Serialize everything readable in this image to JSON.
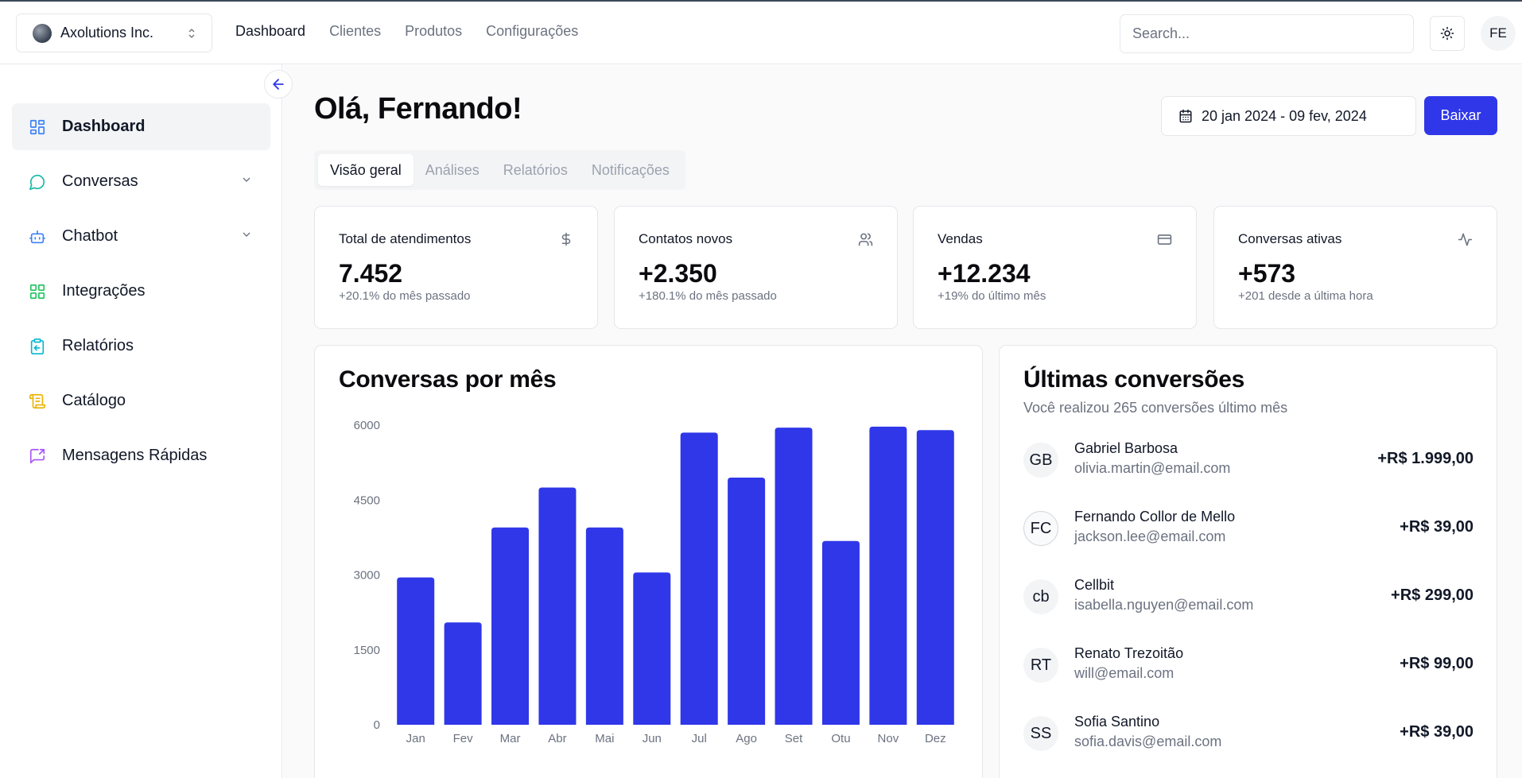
{
  "org": {
    "name": "Axolutions Inc."
  },
  "nav": [
    "Dashboard",
    "Clientes",
    "Produtos",
    "Configurações"
  ],
  "search": {
    "placeholder": "Search..."
  },
  "user": {
    "initials": "FE"
  },
  "sidebar": {
    "items": [
      {
        "label": "Dashboard",
        "icon": "grid-icon",
        "color": "#3b82f6",
        "active": true,
        "expandable": false
      },
      {
        "label": "Conversas",
        "icon": "message-circle-icon",
        "color": "#14b8a6",
        "active": false,
        "expandable": true
      },
      {
        "label": "Chatbot",
        "icon": "bot-icon",
        "color": "#3b82f6",
        "active": false,
        "expandable": true
      },
      {
        "label": "Integrações",
        "icon": "blocks-icon",
        "color": "#22c55e",
        "active": false,
        "expandable": false
      },
      {
        "label": "Relatórios",
        "icon": "clipboard-icon",
        "color": "#06b6d4",
        "active": false,
        "expandable": false
      },
      {
        "label": "Catálogo",
        "icon": "scroll-icon",
        "color": "#eab308",
        "active": false,
        "expandable": false
      },
      {
        "label": "Mensagens Rápidas",
        "icon": "message-share-icon",
        "color": "#a855f7",
        "active": false,
        "expandable": false
      }
    ]
  },
  "main": {
    "greeting": "Olá, Fernando!",
    "date_range": "20 jan 2024 - 09 fev, 2024",
    "download_label": "Baixar",
    "tabs": [
      "Visão geral",
      "Análises",
      "Relatórios",
      "Notificações"
    ],
    "active_tab": "Visão geral"
  },
  "stats": [
    {
      "title": "Total de atendimentos",
      "value": "7.452",
      "sub": "+20.1% do mês passado",
      "icon": "dollar-icon"
    },
    {
      "title": "Contatos novos",
      "value": "+2.350",
      "sub": "+180.1% do mês passado",
      "icon": "users-icon"
    },
    {
      "title": "Vendas",
      "value": "+12.234",
      "sub": "+19% do último mês",
      "icon": "credit-card-icon"
    },
    {
      "title": "Conversas ativas",
      "value": "+573",
      "sub": "+201 desde a última hora",
      "icon": "activity-icon"
    }
  ],
  "chart": {
    "title": "Conversas por mês"
  },
  "chart_data": {
    "type": "bar",
    "title": "Conversas por mês",
    "categories": [
      "Jan",
      "Fev",
      "Mar",
      "Abr",
      "Mai",
      "Jun",
      "Jul",
      "Ago",
      "Set",
      "Otu",
      "Nov",
      "Dez"
    ],
    "values": [
      2950,
      2050,
      3950,
      4750,
      3950,
      3050,
      5850,
      4950,
      5950,
      3680,
      5970,
      5900
    ],
    "yticks": [
      0,
      1500,
      3000,
      4500,
      6000
    ],
    "ylim": [
      0,
      6000
    ],
    "bar_color": "#2f37e8",
    "grid": false
  },
  "conversions": {
    "title": "Últimas conversões",
    "subtitle": "Você realizou 265 conversões último mês",
    "items": [
      {
        "initials": "GB",
        "name": "Gabriel Barbosa",
        "email": "olivia.martin@email.com",
        "amount": "+R$ 1.999,00"
      },
      {
        "initials": "FC",
        "name": "Fernando Collor de Mello",
        "email": "jackson.lee@email.com",
        "amount": "+R$ 39,00"
      },
      {
        "initials": "cb",
        "name": "Cellbit",
        "email": "isabella.nguyen@email.com",
        "amount": "+R$ 299,00"
      },
      {
        "initials": "RT",
        "name": "Renato Trezoitão",
        "email": "will@email.com",
        "amount": "+R$ 99,00"
      },
      {
        "initials": "SS",
        "name": "Sofia Santino",
        "email": "sofia.davis@email.com",
        "amount": "+R$ 39,00"
      }
    ]
  },
  "colors": {
    "accent": "#2f37e8",
    "border": "#e5e7eb",
    "muted": "#6b7280"
  }
}
